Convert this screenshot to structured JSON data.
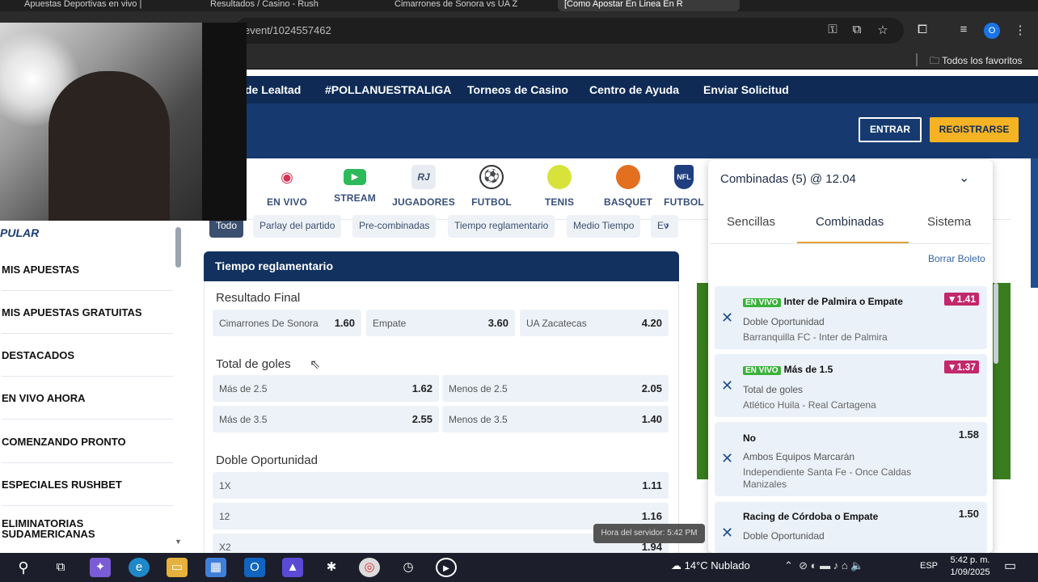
{
  "browser": {
    "tabs": [
      "Apuestas Deportivas en vivo |",
      "Resultados / Casino - Rush",
      "Cimarrones de Sonora vs UA Z",
      "[Como Apostar En Linea En R"
    ],
    "url": "event/1024557462",
    "bookmarks_label": "Todos los favoritos",
    "profile_initial": "O"
  },
  "topnav": {
    "links": [
      "de Lealtad",
      "#POLLANUESTRALIGA",
      "Torneos de Casino",
      "Centro de Ayuda",
      "Enviar Solicitud"
    ]
  },
  "header": {
    "login_label": "ENTRAR",
    "register_label": "REGISTRARSE"
  },
  "sports": [
    {
      "label": "EN VIVO",
      "icon": "live-broadcast-icon",
      "color": "#d33456"
    },
    {
      "label": "STREAM",
      "icon": "play-icon",
      "color": "#2dba5a"
    },
    {
      "label": "JUGADORES",
      "icon": "rj-logo-icon",
      "color": "#3b4f6e"
    },
    {
      "label": "FUTBOL",
      "icon": "soccer-ball-icon",
      "color": "#333333"
    },
    {
      "label": "TENIS",
      "icon": "tennis-ball-icon",
      "color": "#d7e33a"
    },
    {
      "label": "BASQUET",
      "icon": "basketball-icon",
      "color": "#e2701f"
    },
    {
      "label": "FUTBOL",
      "icon": "nfl-shield-icon",
      "color": "#1f3e80"
    }
  ],
  "sidebar": {
    "title": "PULAR",
    "items": [
      "MIS APUESTAS",
      "MIS APUESTAS GRATUITAS",
      "DESTACADOS",
      "EN VIVO AHORA",
      "COMENZANDO PRONTO",
      "ESPECIALES RUSHBET",
      "ELIMINATORIAS SUDAMERICANAS"
    ]
  },
  "market_tabs": [
    "Todo",
    "Parlay del partido",
    "Pre-combinadas",
    "Tiempo reglamentario",
    "Medio Tiempo",
    "Ev"
  ],
  "markets": {
    "header": "Tiempo reglamentario",
    "resultado": {
      "title": "Resultado Final",
      "odds": [
        {
          "name": "Cimarrones De Sonora",
          "value": "1.60"
        },
        {
          "name": "Empate",
          "value": "3.60"
        },
        {
          "name": "UA Zacatecas",
          "value": "4.20"
        }
      ]
    },
    "goles": {
      "title": "Total de goles",
      "odds": [
        {
          "name": "Más de  2.5",
          "value": "1.62"
        },
        {
          "name": "Menos de  2.5",
          "value": "2.05"
        },
        {
          "name": "Más de  3.5",
          "value": "2.55"
        },
        {
          "name": "Menos de  3.5",
          "value": "1.40"
        }
      ]
    },
    "doble": {
      "title": "Doble Oportunidad",
      "odds": [
        {
          "name": "1X",
          "value": "1.11"
        },
        {
          "name": "12",
          "value": "1.16"
        },
        {
          "name": "X2",
          "value": "1.94"
        }
      ]
    }
  },
  "betslip": {
    "title": "Combinadas (5) @ 12.04",
    "tabs": [
      "Sencillas",
      "Combinadas",
      "Sistema"
    ],
    "clear_label": "Borrar Boleto",
    "live_badge": "EN VIVO",
    "bets": [
      {
        "selection": "Inter de Palmira o Empate",
        "market": "Doble Oportunidad",
        "event": "Barranquilla FC - Inter de Palmira",
        "price": "1.41",
        "live": true,
        "trend": "down"
      },
      {
        "selection": "Más de 1.5",
        "market": "Total de goles",
        "event": "Atlético Huila - Real Cartagena",
        "price": "1.37",
        "live": true,
        "trend": "down"
      },
      {
        "selection": "No",
        "market": "Ambos Equipos Marcarán",
        "event": "Independiente Santa Fe - Once Caldas Manizales",
        "price": "1.58",
        "live": false,
        "trend": "none"
      },
      {
        "selection": "Racing de Córdoba o Empate",
        "market": "Doble Oportunidad",
        "event": "",
        "price": "1.50",
        "live": false,
        "trend": "none"
      }
    ]
  },
  "tooltip": "Hora del servidor: 5:42 PM",
  "taskbar": {
    "weather": "14°C  Nublado",
    "lang": "ESP",
    "time": "5:42 p. m.",
    "date": "1/09/2025"
  },
  "colors": {
    "nav_dark": "#0e2a55",
    "header_blue": "#163a70",
    "accent_yellow": "#f5b324",
    "odds_bg": "#edf2f8",
    "live_green": "#3bb33b",
    "price_down": "#c2286a"
  }
}
